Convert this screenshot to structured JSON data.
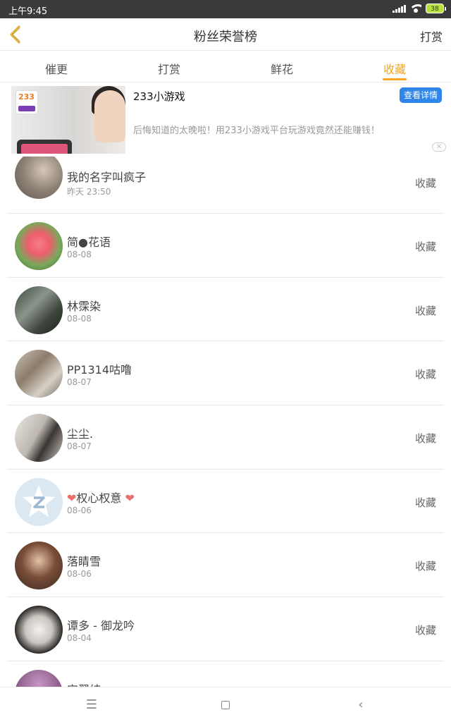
{
  "status_bar": {
    "time": "上午9:45",
    "battery": "38"
  },
  "header": {
    "title": "粉丝荣誉榜",
    "action": "打赏"
  },
  "tabs": [
    {
      "label": "催更",
      "active": false
    },
    {
      "label": "打赏",
      "active": false
    },
    {
      "label": "鲜花",
      "active": false
    },
    {
      "label": "收藏",
      "active": true
    }
  ],
  "ad": {
    "title": "233小游戏",
    "detail_button": "查看详情",
    "description": "后悔知道的太晚啦！用233小游戏平台玩游戏竟然还能赚钱！",
    "logo_text": "233"
  },
  "fans": [
    {
      "name": "我的名字叫疯子",
      "date": "昨天 23:50",
      "action": "收藏"
    },
    {
      "name": "简●花语",
      "date": "08-08",
      "action": "收藏"
    },
    {
      "name": "林霂染",
      "date": "08-08",
      "action": "收藏"
    },
    {
      "name": "PP1314咕噜",
      "date": "08-07",
      "action": "收藏"
    },
    {
      "name": "尘尘.",
      "date": "08-07",
      "action": "收藏"
    },
    {
      "name": "权心权意",
      "date": "08-06",
      "action": "收藏"
    },
    {
      "name": "落睛雪",
      "date": "08-06",
      "action": "收藏"
    },
    {
      "name": "谭多 - 御龙吟",
      "date": "08-04",
      "action": "收藏"
    },
    {
      "name": "安翠纯",
      "date": "",
      "action": ""
    }
  ],
  "colors": {
    "accent": "#f5a623",
    "ad_button": "#2f86e8",
    "heart": "#e8706d"
  }
}
